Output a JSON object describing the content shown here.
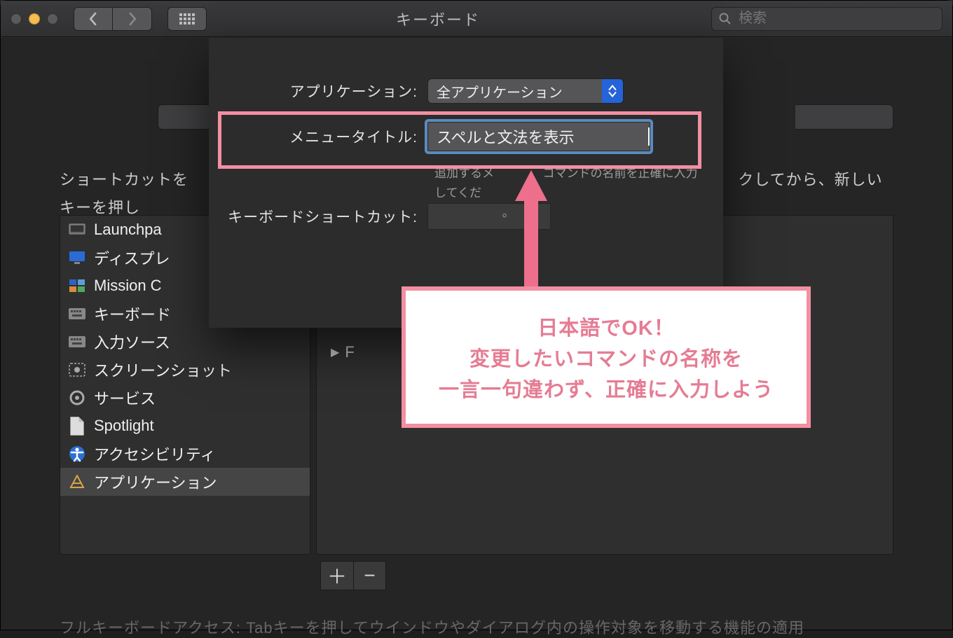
{
  "window": {
    "title": "キーボード",
    "search_placeholder": "検索"
  },
  "body": {
    "instr_part_1": "ショートカットを",
    "instr_part_2": "クしてから、新しいキーを押し",
    "sidebar": {
      "items": [
        {
          "label": "Launchpa"
        },
        {
          "label": "ディスプレ"
        },
        {
          "label": "Mission C"
        },
        {
          "label": "キーボード"
        },
        {
          "label": "入力ソース"
        },
        {
          "label": "スクリーンショット"
        },
        {
          "label": "サービス"
        },
        {
          "label": "Spotlight"
        },
        {
          "label": "アクセシビリティ"
        },
        {
          "label": "アプリケーション"
        }
      ]
    },
    "right_list": {
      "item": "F"
    },
    "plus": "＋",
    "minus": "−",
    "footer": "フルキーボードアクセス: Tabキーを押してウインドウやダイアログ内の操作対象を移動する機能の適用"
  },
  "sheet": {
    "app_label": "アプリケーション:",
    "app_value": "全アプリケーション",
    "menu_label": "メニュータイトル:",
    "menu_value": "スペルと文法を表示",
    "hint_1": "追加するメ",
    "hint_2": "コマンドの名前を正確に入力してくだ",
    "hint_suffix": "。",
    "shortcut_label": "キーボードショートカット:"
  },
  "callout": {
    "line1": "日本語でOK！",
    "line2": "変更したいコマンドの名称を",
    "line3": "一言一句違わず、正確に入力しよう"
  }
}
